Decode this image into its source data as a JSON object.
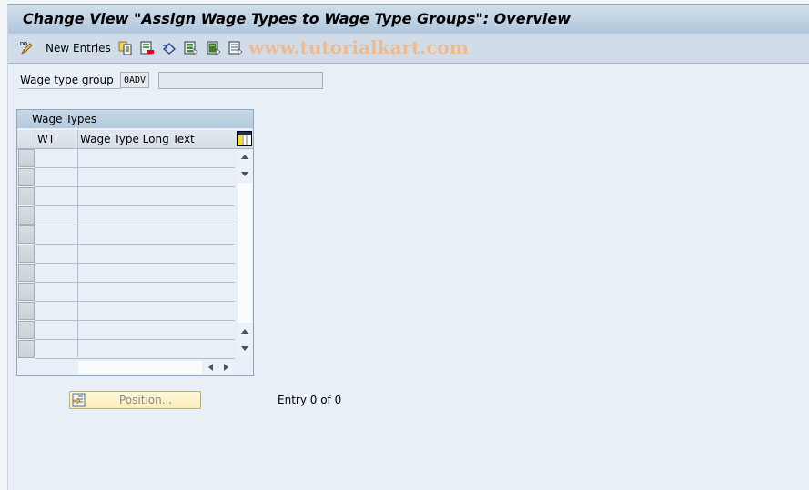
{
  "window": {
    "title": "Change View \"Assign Wage Types to Wage Type Groups\": Overview"
  },
  "toolbar": {
    "new_entries_label": "New Entries",
    "icons": [
      {
        "name": "display-change-icon"
      },
      {
        "name": "copy-as-icon"
      },
      {
        "name": "delete-icon"
      },
      {
        "name": "undo-change-icon"
      },
      {
        "name": "select-all-icon"
      },
      {
        "name": "select-block-icon"
      },
      {
        "name": "deselect-all-icon"
      }
    ],
    "watermark": "www.tutorialkart.com"
  },
  "header_fields": {
    "wage_type_group_label": "Wage type group",
    "wage_type_group_value": "0ADV",
    "wage_type_group_text": ""
  },
  "table": {
    "caption": "Wage Types",
    "columns": [
      "WT",
      "Wage Type Long Text"
    ],
    "rows": [],
    "visible_empty_rows": 11,
    "settings_icon": "table-settings-icon"
  },
  "footer": {
    "position_button_label": "Position...",
    "entry_count": "Entry 0 of 0"
  },
  "colors": {
    "title_bar": "#b0c6dc",
    "toolbar": "#d0dde8",
    "background": "#e8eff6",
    "button_bg": "#fbeeb8",
    "watermark": "#f0b98c"
  }
}
